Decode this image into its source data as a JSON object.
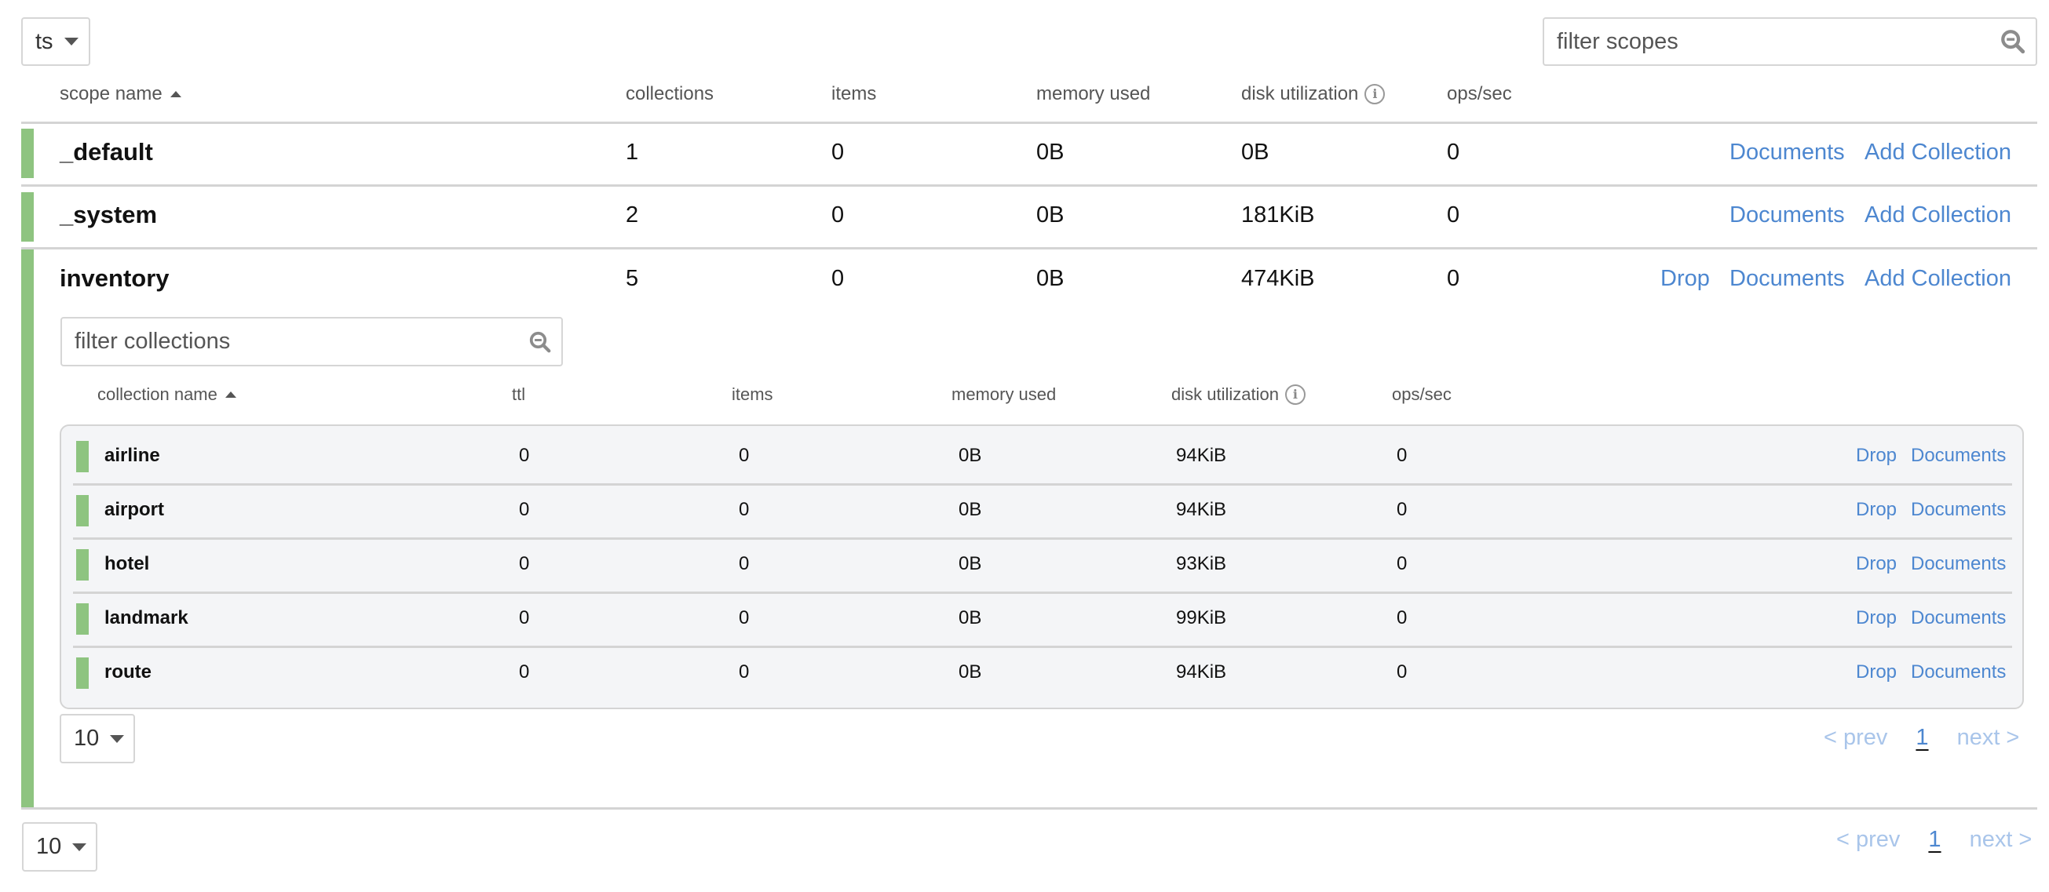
{
  "bucket_selector": {
    "value": "ts"
  },
  "scope_filter": {
    "placeholder": "filter scopes",
    "icon": "search-minus-icon"
  },
  "scope_table": {
    "headers": {
      "name": "scope name",
      "collections": "collections",
      "items": "items",
      "memory_used": "memory used",
      "disk_utilization": "disk utilization",
      "ops_sec": "ops/sec"
    },
    "sort": {
      "column": "scope name",
      "direction": "ascending"
    },
    "rows": [
      {
        "name": "_default",
        "collections": "1",
        "items": "0",
        "memory_used": "0B",
        "disk_utilization": "0B",
        "ops_sec": "0",
        "actions": [
          "Documents",
          "Add Collection"
        ],
        "status_color": "#8ec480"
      },
      {
        "name": "_system",
        "collections": "2",
        "items": "0",
        "memory_used": "0B",
        "disk_utilization": "181KiB",
        "ops_sec": "0",
        "actions": [
          "Documents",
          "Add Collection"
        ],
        "status_color": "#8ec480"
      },
      {
        "name": "inventory",
        "collections": "5",
        "items": "0",
        "memory_used": "0B",
        "disk_utilization": "474KiB",
        "ops_sec": "0",
        "actions": [
          "Drop",
          "Documents",
          "Add Collection"
        ],
        "status_color": "#8ec480",
        "expanded": true
      }
    ]
  },
  "collection_filter": {
    "placeholder": "filter collections",
    "icon": "search-minus-icon"
  },
  "collection_table": {
    "headers": {
      "name": "collection name",
      "ttl": "ttl",
      "items": "items",
      "memory_used": "memory used",
      "disk_utilization": "disk utilization",
      "ops_sec": "ops/sec"
    },
    "sort": {
      "column": "collection name",
      "direction": "ascending"
    },
    "rows": [
      {
        "name": "airline",
        "ttl": "0",
        "items": "0",
        "memory_used": "0B",
        "disk_utilization": "94KiB",
        "ops_sec": "0",
        "actions": [
          "Drop",
          "Documents"
        ]
      },
      {
        "name": "airport",
        "ttl": "0",
        "items": "0",
        "memory_used": "0B",
        "disk_utilization": "94KiB",
        "ops_sec": "0",
        "actions": [
          "Drop",
          "Documents"
        ]
      },
      {
        "name": "hotel",
        "ttl": "0",
        "items": "0",
        "memory_used": "0B",
        "disk_utilization": "93KiB",
        "ops_sec": "0",
        "actions": [
          "Drop",
          "Documents"
        ]
      },
      {
        "name": "landmark",
        "ttl": "0",
        "items": "0",
        "memory_used": "0B",
        "disk_utilization": "99KiB",
        "ops_sec": "0",
        "actions": [
          "Drop",
          "Documents"
        ]
      },
      {
        "name": "route",
        "ttl": "0",
        "items": "0",
        "memory_used": "0B",
        "disk_utilization": "94KiB",
        "ops_sec": "0",
        "actions": [
          "Drop",
          "Documents"
        ]
      }
    ],
    "page_size": "10",
    "pagination": {
      "prev": "< prev",
      "current": "1",
      "next": "next >"
    }
  },
  "scope_pagination": {
    "page_size": "10",
    "prev": "< prev",
    "current": "1",
    "next": "next >"
  },
  "colors": {
    "status_ok": "#8ec480",
    "link": "#4d87d0",
    "link_disabled": "#a9c5ea",
    "inner_panel_bg": "#f4f5f7"
  }
}
